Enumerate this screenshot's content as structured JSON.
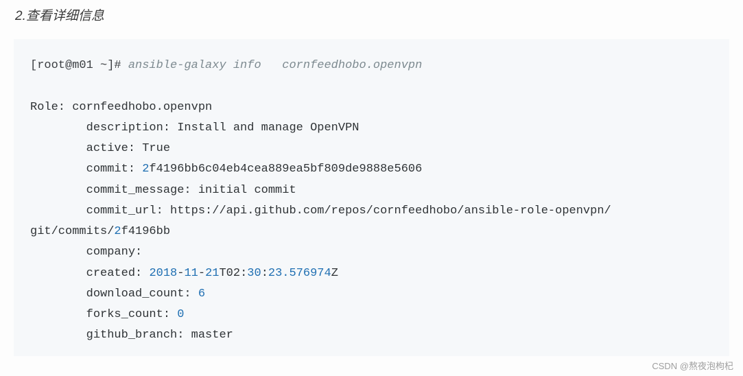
{
  "heading": "2.查看详细信息",
  "prompt": "[root@m01 ~]#",
  "command_comment": " ansible-galaxy info   cornfeedhobo.openvpn",
  "output": {
    "role_line": "Role: cornfeedhobo.openvpn",
    "description_line": "        description: Install and manage OpenVPN",
    "active_line": "        active: True",
    "commit_prefix": "        commit: ",
    "commit_num": "2",
    "commit_rest": "f4196bb6c04eb4cea889ea5bf809de9888e5606",
    "commit_message_line": "        commit_message: initial commit",
    "commit_url_line": "        commit_url: https://api.github.com/repos/cornfeedhobo/ansible-role-openvpn/",
    "git_commits_prefix": "git/commits/",
    "git_commits_num": "2",
    "git_commits_rest": "f4196bb",
    "company_line": "        company:",
    "created_prefix": "        created: ",
    "created_year": "2018",
    "created_dash1": "-",
    "created_month": "11",
    "created_dash2": "-",
    "created_day": "21",
    "created_T": "T02:",
    "created_min": "30",
    "created_colon": ":",
    "created_sec": "23.576974",
    "created_Z": "Z",
    "download_count_prefix": "        download_count: ",
    "download_count_value": "6",
    "forks_count_prefix": "        forks_count: ",
    "forks_count_value": "0",
    "github_branch_line": "        github_branch: master"
  },
  "watermark": "CSDN @熬夜泡枸杞"
}
